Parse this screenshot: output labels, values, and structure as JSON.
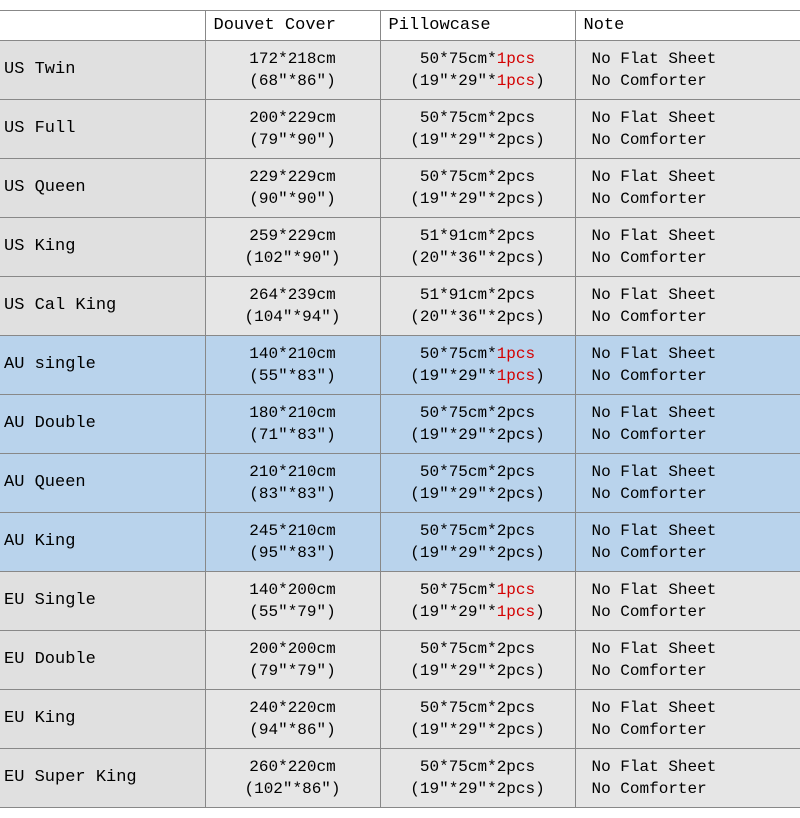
{
  "headers": {
    "blank": "",
    "duvet": "Douvet Cover",
    "pillow": "Pillowcase",
    "note": "Note"
  },
  "note_lines": {
    "l1": "No Flat Sheet",
    "l2": "No Comforter"
  },
  "rows": [
    {
      "region": "us",
      "size": "US Twin",
      "duvet_cm": "172*218cm",
      "duvet_in": "(68\"*86\")",
      "pillow_cm_pre": "50*75cm*",
      "pillow_cm_red": "1pcs",
      "pillow_cm_post": "",
      "pillow_in_pre": "(19\"*29\"*",
      "pillow_in_red": "1pcs",
      "pillow_in_post": ")"
    },
    {
      "region": "us",
      "size": "US Full",
      "duvet_cm": "200*229cm",
      "duvet_in": "(79\"*90\")",
      "pillow_cm_pre": "50*75cm*2pcs",
      "pillow_cm_red": "",
      "pillow_cm_post": "",
      "pillow_in_pre": "(19\"*29\"*2pcs)",
      "pillow_in_red": "",
      "pillow_in_post": ""
    },
    {
      "region": "us",
      "size": "US Queen",
      "duvet_cm": "229*229cm",
      "duvet_in": "(90\"*90\")",
      "pillow_cm_pre": "50*75cm*2pcs",
      "pillow_cm_red": "",
      "pillow_cm_post": "",
      "pillow_in_pre": "(19\"*29\"*2pcs)",
      "pillow_in_red": "",
      "pillow_in_post": ""
    },
    {
      "region": "us",
      "size": "US King",
      "duvet_cm": "259*229cm",
      "duvet_in": "(102\"*90\")",
      "pillow_cm_pre": "51*91cm*2pcs",
      "pillow_cm_red": "",
      "pillow_cm_post": "",
      "pillow_in_pre": "(20\"*36\"*2pcs)",
      "pillow_in_red": "",
      "pillow_in_post": ""
    },
    {
      "region": "us",
      "size": "US Cal King",
      "duvet_cm": "264*239cm",
      "duvet_in": "(104\"*94\")",
      "pillow_cm_pre": "51*91cm*2pcs",
      "pillow_cm_red": "",
      "pillow_cm_post": "",
      "pillow_in_pre": "(20\"*36\"*2pcs)",
      "pillow_in_red": "",
      "pillow_in_post": ""
    },
    {
      "region": "au",
      "size": "AU single",
      "duvet_cm": "140*210cm",
      "duvet_in": "(55\"*83\")",
      "pillow_cm_pre": "50*75cm*",
      "pillow_cm_red": "1pcs",
      "pillow_cm_post": "",
      "pillow_in_pre": "(19\"*29\"*",
      "pillow_in_red": "1pcs",
      "pillow_in_post": ")"
    },
    {
      "region": "au",
      "size": "AU Double",
      "duvet_cm": "180*210cm",
      "duvet_in": "(71\"*83\")",
      "pillow_cm_pre": "50*75cm*2pcs",
      "pillow_cm_red": "",
      "pillow_cm_post": "",
      "pillow_in_pre": "(19\"*29\"*2pcs)",
      "pillow_in_red": "",
      "pillow_in_post": ""
    },
    {
      "region": "au",
      "size": "AU Queen",
      "duvet_cm": "210*210cm",
      "duvet_in": "(83\"*83\")",
      "pillow_cm_pre": "50*75cm*2pcs",
      "pillow_cm_red": "",
      "pillow_cm_post": "",
      "pillow_in_pre": "(19\"*29\"*2pcs)",
      "pillow_in_red": "",
      "pillow_in_post": ""
    },
    {
      "region": "au",
      "size": "AU King",
      "duvet_cm": "245*210cm",
      "duvet_in": "(95\"*83\")",
      "pillow_cm_pre": "50*75cm*2pcs",
      "pillow_cm_red": "",
      "pillow_cm_post": "",
      "pillow_in_pre": "(19\"*29\"*2pcs)",
      "pillow_in_red": "",
      "pillow_in_post": ""
    },
    {
      "region": "eu",
      "size": "EU Single",
      "duvet_cm": "140*200cm",
      "duvet_in": "(55\"*79\")",
      "pillow_cm_pre": "50*75cm*",
      "pillow_cm_red": "1pcs",
      "pillow_cm_post": "",
      "pillow_in_pre": "(19\"*29\"*",
      "pillow_in_red": "1pcs",
      "pillow_in_post": ")"
    },
    {
      "region": "eu",
      "size": "EU Double",
      "duvet_cm": "200*200cm",
      "duvet_in": "(79\"*79\")",
      "pillow_cm_pre": "50*75cm*2pcs",
      "pillow_cm_red": "",
      "pillow_cm_post": "",
      "pillow_in_pre": "(19\"*29\"*2pcs)",
      "pillow_in_red": "",
      "pillow_in_post": ""
    },
    {
      "region": "eu",
      "size": "EU King",
      "duvet_cm": "240*220cm",
      "duvet_in": "(94\"*86\")",
      "pillow_cm_pre": "50*75cm*2pcs",
      "pillow_cm_red": "",
      "pillow_cm_post": "",
      "pillow_in_pre": "(19\"*29\"*2pcs)",
      "pillow_in_red": "",
      "pillow_in_post": ""
    },
    {
      "region": "eu",
      "size": "EU Super King",
      "duvet_cm": "260*220cm",
      "duvet_in": "(102\"*86\")",
      "pillow_cm_pre": "50*75cm*2pcs",
      "pillow_cm_red": "",
      "pillow_cm_post": "",
      "pillow_in_pre": "(19\"*29\"*2pcs)",
      "pillow_in_red": "",
      "pillow_in_post": ""
    }
  ]
}
